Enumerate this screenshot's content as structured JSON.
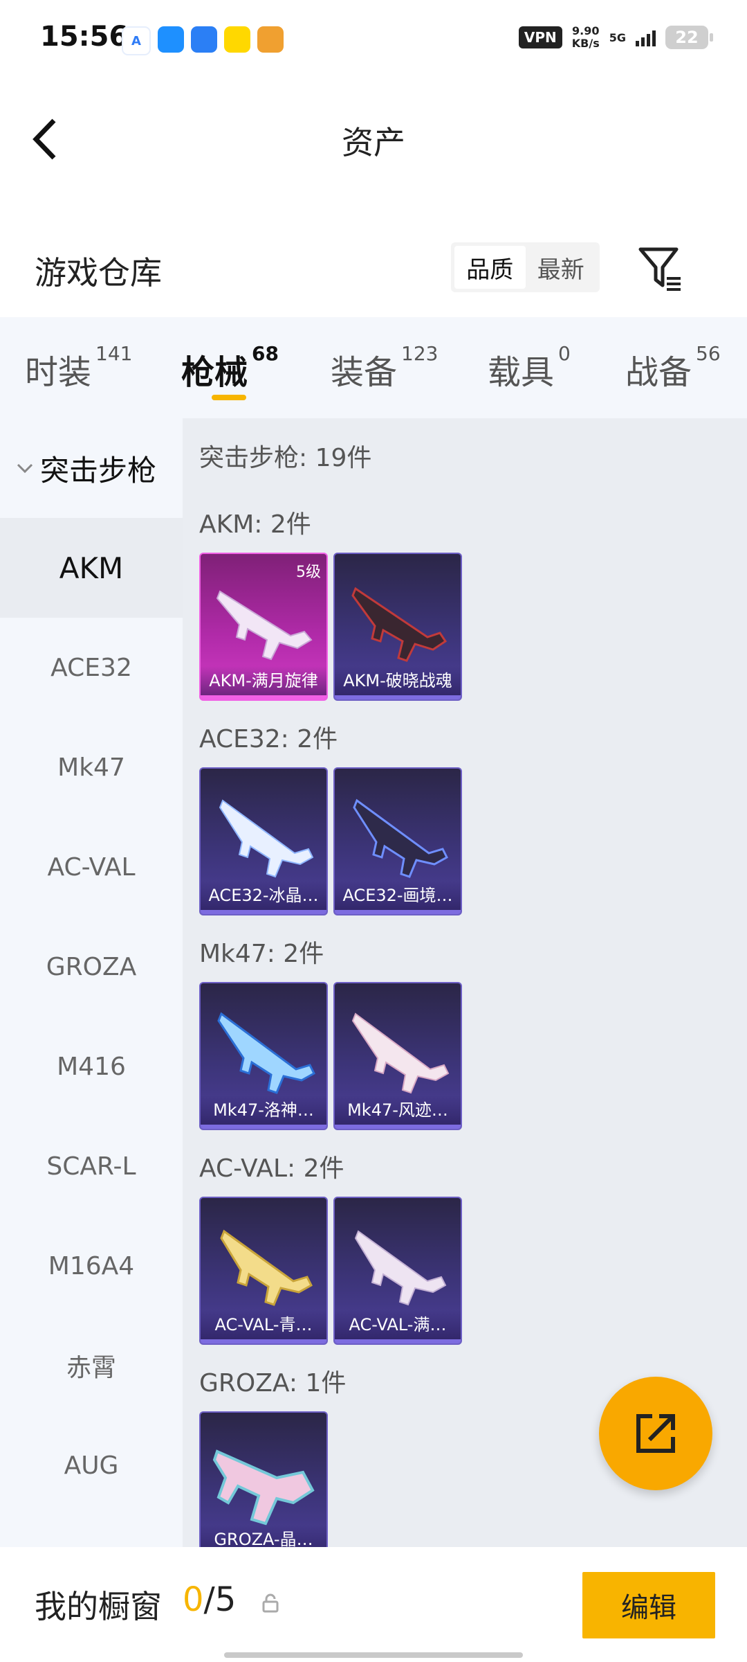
{
  "status_bar": {
    "time": "15:56",
    "apps": [
      "A",
      "",
      "",
      "",
      ""
    ],
    "vpn": "VPN",
    "speed_value": "9.90",
    "speed_unit": "KB/s",
    "network": "5G",
    "battery": "22"
  },
  "header": {
    "title": "资产",
    "back_icon": "chevron-left-icon"
  },
  "warehouse": {
    "title": "游戏仓库",
    "sort_options": [
      "品质",
      "最新"
    ],
    "sort_selected": "品质",
    "filter_icon": "filter-icon"
  },
  "tabs": [
    {
      "label": "时装",
      "count": "141"
    },
    {
      "label": "枪械",
      "count": "68"
    },
    {
      "label": "装备",
      "count": "123"
    },
    {
      "label": "载具",
      "count": "0"
    },
    {
      "label": "战备",
      "count": "56"
    }
  ],
  "active_tab": "枪械",
  "sidebar": {
    "group": "突击步枪",
    "items": [
      "AKM",
      "ACE32",
      "Mk47",
      "AC-VAL",
      "GROZA",
      "M416",
      "SCAR-L",
      "M16A4",
      "赤霄",
      "AUG"
    ],
    "active": "AKM"
  },
  "content": {
    "category_count": "突击步枪: 19件",
    "groups": [
      {
        "title": "AKM: 2件",
        "items": [
          {
            "name": "AKM-满月旋律",
            "level": "5级"
          },
          {
            "name": "AKM-破晓战魂"
          }
        ]
      },
      {
        "title": "ACE32: 2件",
        "items": [
          {
            "name": "ACE32-冰晶…"
          },
          {
            "name": "ACE32-画境…"
          }
        ]
      },
      {
        "title": "Mk47: 2件",
        "items": [
          {
            "name": "Mk47-洛神…"
          },
          {
            "name": "Mk47-风迹…"
          }
        ]
      },
      {
        "title": "AC-VAL: 2件",
        "items": [
          {
            "name": "AC-VAL-青…"
          },
          {
            "name": "AC-VAL-满…"
          }
        ]
      },
      {
        "title": "GROZA: 1件",
        "items": [
          {
            "name": "GROZA-晶…"
          }
        ]
      }
    ]
  },
  "fab": {
    "icon": "share-external-icon"
  },
  "bottom": {
    "label": "我的橱窗",
    "count_current": "0",
    "count_total": "/5",
    "lock_icon": "lock-icon",
    "edit_label": "编辑"
  },
  "colors": {
    "accent": "#f7b500",
    "fab": "#f9a800",
    "card_rare": "#d23bc6",
    "card_normal": "#3c3478"
  }
}
